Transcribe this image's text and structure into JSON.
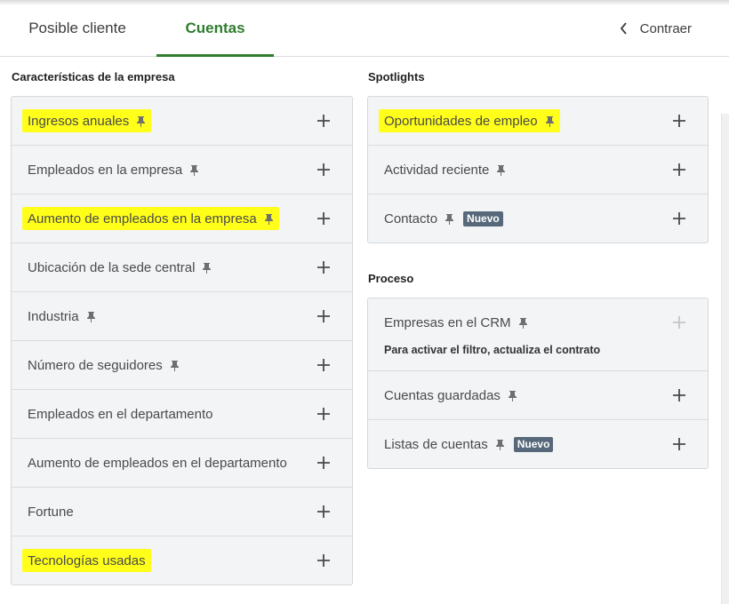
{
  "tabs": {
    "prospect": "Posible cliente",
    "accounts": "Cuentas",
    "collapse": "Contraer"
  },
  "company": {
    "title": "Características de la empresa",
    "items": [
      {
        "label": "Ingresos anuales",
        "pinned": true,
        "highlight": true
      },
      {
        "label": "Empleados en la empresa",
        "pinned": true,
        "highlight": false
      },
      {
        "label": "Aumento de empleados en la empresa",
        "pinned": true,
        "highlight": true
      },
      {
        "label": "Ubicación de la sede central",
        "pinned": true,
        "highlight": false
      },
      {
        "label": "Industria",
        "pinned": true,
        "highlight": false
      },
      {
        "label": "Número de seguidores",
        "pinned": true,
        "highlight": false
      },
      {
        "label": "Empleados en el departamento",
        "pinned": false,
        "highlight": false
      },
      {
        "label": "Aumento de empleados en el departamento",
        "pinned": false,
        "highlight": false
      },
      {
        "label": "Fortune",
        "pinned": false,
        "highlight": false
      },
      {
        "label": "Tecnologías usadas",
        "pinned": false,
        "highlight": true
      }
    ]
  },
  "spotlights": {
    "title": "Spotlights",
    "items": [
      {
        "label": "Oportunidades de empleo",
        "pinned": true,
        "highlight": true
      },
      {
        "label": "Actividad reciente",
        "pinned": true,
        "highlight": false
      },
      {
        "label": "Contacto",
        "pinned": true,
        "highlight": false,
        "badge": "Nuevo"
      }
    ]
  },
  "process": {
    "title": "Proceso",
    "items": [
      {
        "label": "Empresas en el CRM",
        "pinned": true,
        "disabled": true,
        "note": "Para activar el filtro, actualiza el contrato"
      },
      {
        "label": "Cuentas guardadas",
        "pinned": true
      },
      {
        "label": "Listas de cuentas",
        "pinned": true,
        "badge": "Nuevo"
      }
    ]
  },
  "colors": {
    "accent": "#2e7d2e",
    "highlight": "#ffff1a",
    "panel": "#f2f4f6",
    "badge": "#56687a"
  }
}
